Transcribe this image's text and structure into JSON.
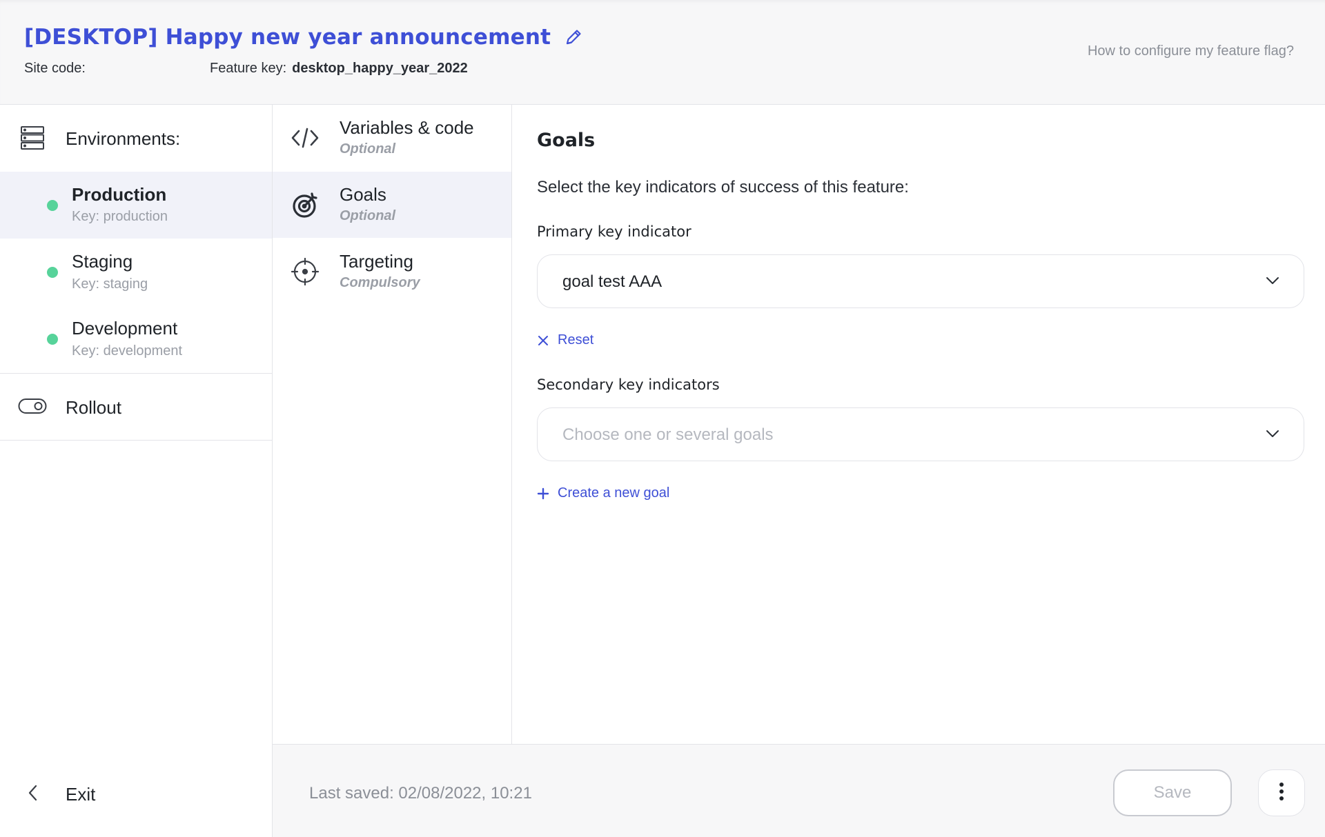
{
  "header": {
    "title": "[DESKTOP] Happy new year announcement",
    "site_code_label": "Site code:",
    "feature_key_label": "Feature key:",
    "feature_key_value": "desktop_happy_year_2022",
    "help_link": "How to configure my feature flag?"
  },
  "sidebar": {
    "environments_label": "Environments:",
    "environments": [
      {
        "name": "Production",
        "key": "Key: production",
        "active": true
      },
      {
        "name": "Staging",
        "key": "Key: staging",
        "active": false
      },
      {
        "name": "Development",
        "key": "Key: development",
        "active": false
      }
    ],
    "rollout_label": "Rollout",
    "exit_label": "Exit"
  },
  "steps": [
    {
      "name": "Variables & code",
      "status": "Optional",
      "icon": "code-icon",
      "active": false
    },
    {
      "name": "Goals",
      "status": "Optional",
      "icon": "target-icon",
      "active": true
    },
    {
      "name": "Targeting",
      "status": "Compulsory",
      "icon": "crosshair-icon",
      "active": false
    }
  ],
  "goals": {
    "title": "Goals",
    "description": "Select the key indicators of success of this feature:",
    "primary_label": "Primary key indicator",
    "primary_value": "goal test AAA",
    "reset_label": "Reset",
    "secondary_label": "Secondary key indicators",
    "secondary_placeholder": "Choose one or several goals",
    "create_label": "Create a new goal"
  },
  "footer": {
    "last_saved": "Last saved: 02/08/2022, 10:21",
    "save_label": "Save"
  },
  "colors": {
    "accent": "#3e4fd6",
    "status_green": "#57d39a",
    "active_bg": "#f1f2f9"
  }
}
